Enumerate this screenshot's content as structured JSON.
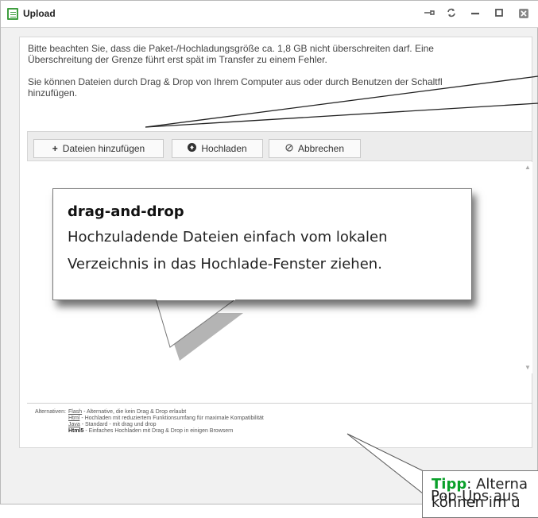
{
  "window": {
    "title": "Upload",
    "pin_icon": "pin-icon",
    "refresh_icon": "refresh-icon",
    "minimize_icon": "minimize-icon",
    "maximize_icon": "maximize-icon",
    "close_icon": "close-icon"
  },
  "info": {
    "line1": "Bitte beachten Sie, dass die Paket-/Hochladungsgröße ca. 1,8 GB nicht überschreiten darf. Eine",
    "line2": "Überschreitung der Grenze führt erst spät im Transfer zu einem Fehler.",
    "line3": "Sie können Dateien durch Drag & Drop von Ihrem Computer aus oder durch Benutzen der Schaltfl",
    "line4": "hinzufügen."
  },
  "toolbar": {
    "add_label": "Dateien hinzufügen",
    "add_icon": "+",
    "upload_label": "Hochladen",
    "upload_icon": "upload-icon",
    "cancel_label": "Abbrechen",
    "cancel_icon": "cancel-icon"
  },
  "alternatives": {
    "label": "Alternativen:",
    "items": [
      {
        "name": "Flash",
        "desc": " - Alternative, die kein Drag & Drop erlaubt"
      },
      {
        "name": "Html",
        "desc": " - Hochladen mit reduziertem Funktionsumfang für maximale Kompatibilität"
      },
      {
        "name": "Java",
        "desc": " - Standard - mit drag und drop"
      },
      {
        "name": "Html5",
        "desc": " - Einfaches Hochladen mit Drag & Drop in einigen Browsern"
      }
    ]
  },
  "callout_main": {
    "heading": "drag-and-drop",
    "line1": "Hochzuladende Dateien einfach vom lokalen",
    "line2": "Verzeichnis in das Hochlade-Fenster ziehen."
  },
  "callout_tip": {
    "tip_word": "Tipp",
    "line1_rest": ": Alterna",
    "line2": "können im u",
    "line3": "Pop-Ups aus"
  }
}
